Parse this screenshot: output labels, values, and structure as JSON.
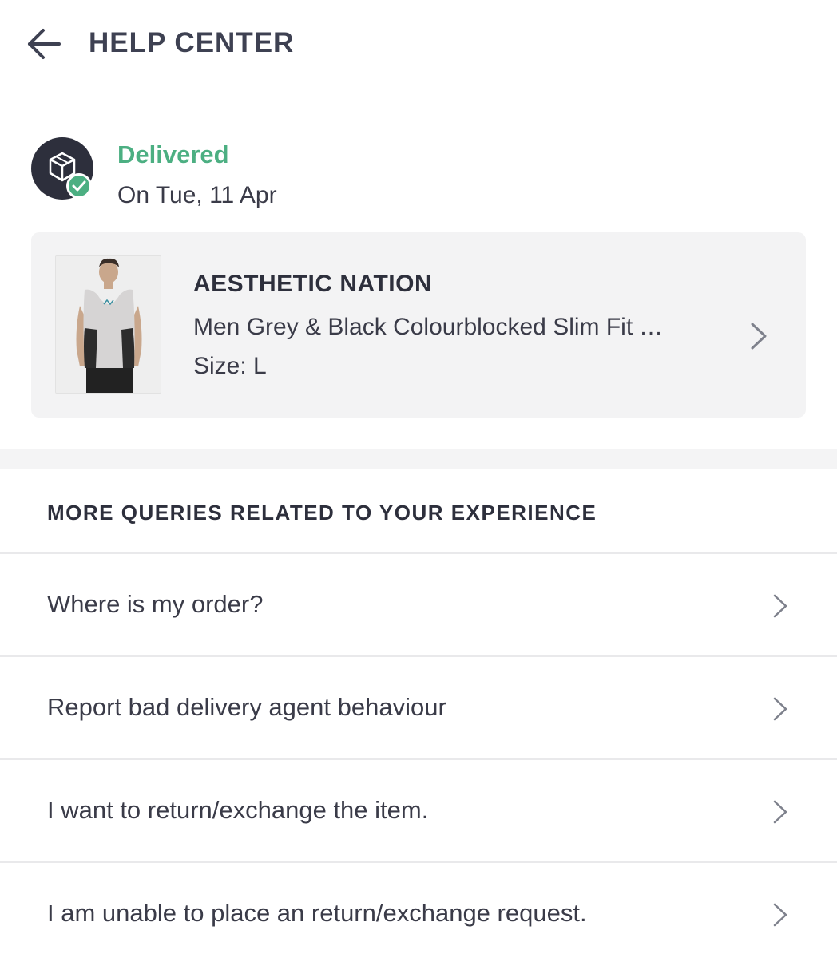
{
  "header": {
    "title": "HELP CENTER",
    "back_icon": "arrow-left-icon"
  },
  "order_status": {
    "icon": "package-delivered-icon",
    "label": "Delivered",
    "date": "On Tue, 11 Apr",
    "status_color": "#4caf82"
  },
  "product": {
    "brand": "AESTHETIC NATION",
    "name": "Men Grey & Black Colourblocked Slim Fit Tank Top",
    "size": "Size: L",
    "chevron_icon": "chevron-right-icon"
  },
  "queries": {
    "heading": "MORE QUERIES RELATED TO YOUR EXPERIENCE",
    "items": [
      {
        "label": "Where is my order?"
      },
      {
        "label": "Report bad delivery agent behaviour"
      },
      {
        "label": "I want to return/exchange the item."
      },
      {
        "label": "I am unable to place an return/exchange request."
      }
    ]
  },
  "colors": {
    "text_dark": "#3e4152",
    "card_background": "#f3f3f4",
    "icon_background": "#2d2f3c",
    "divider": "#e9e9eb"
  }
}
